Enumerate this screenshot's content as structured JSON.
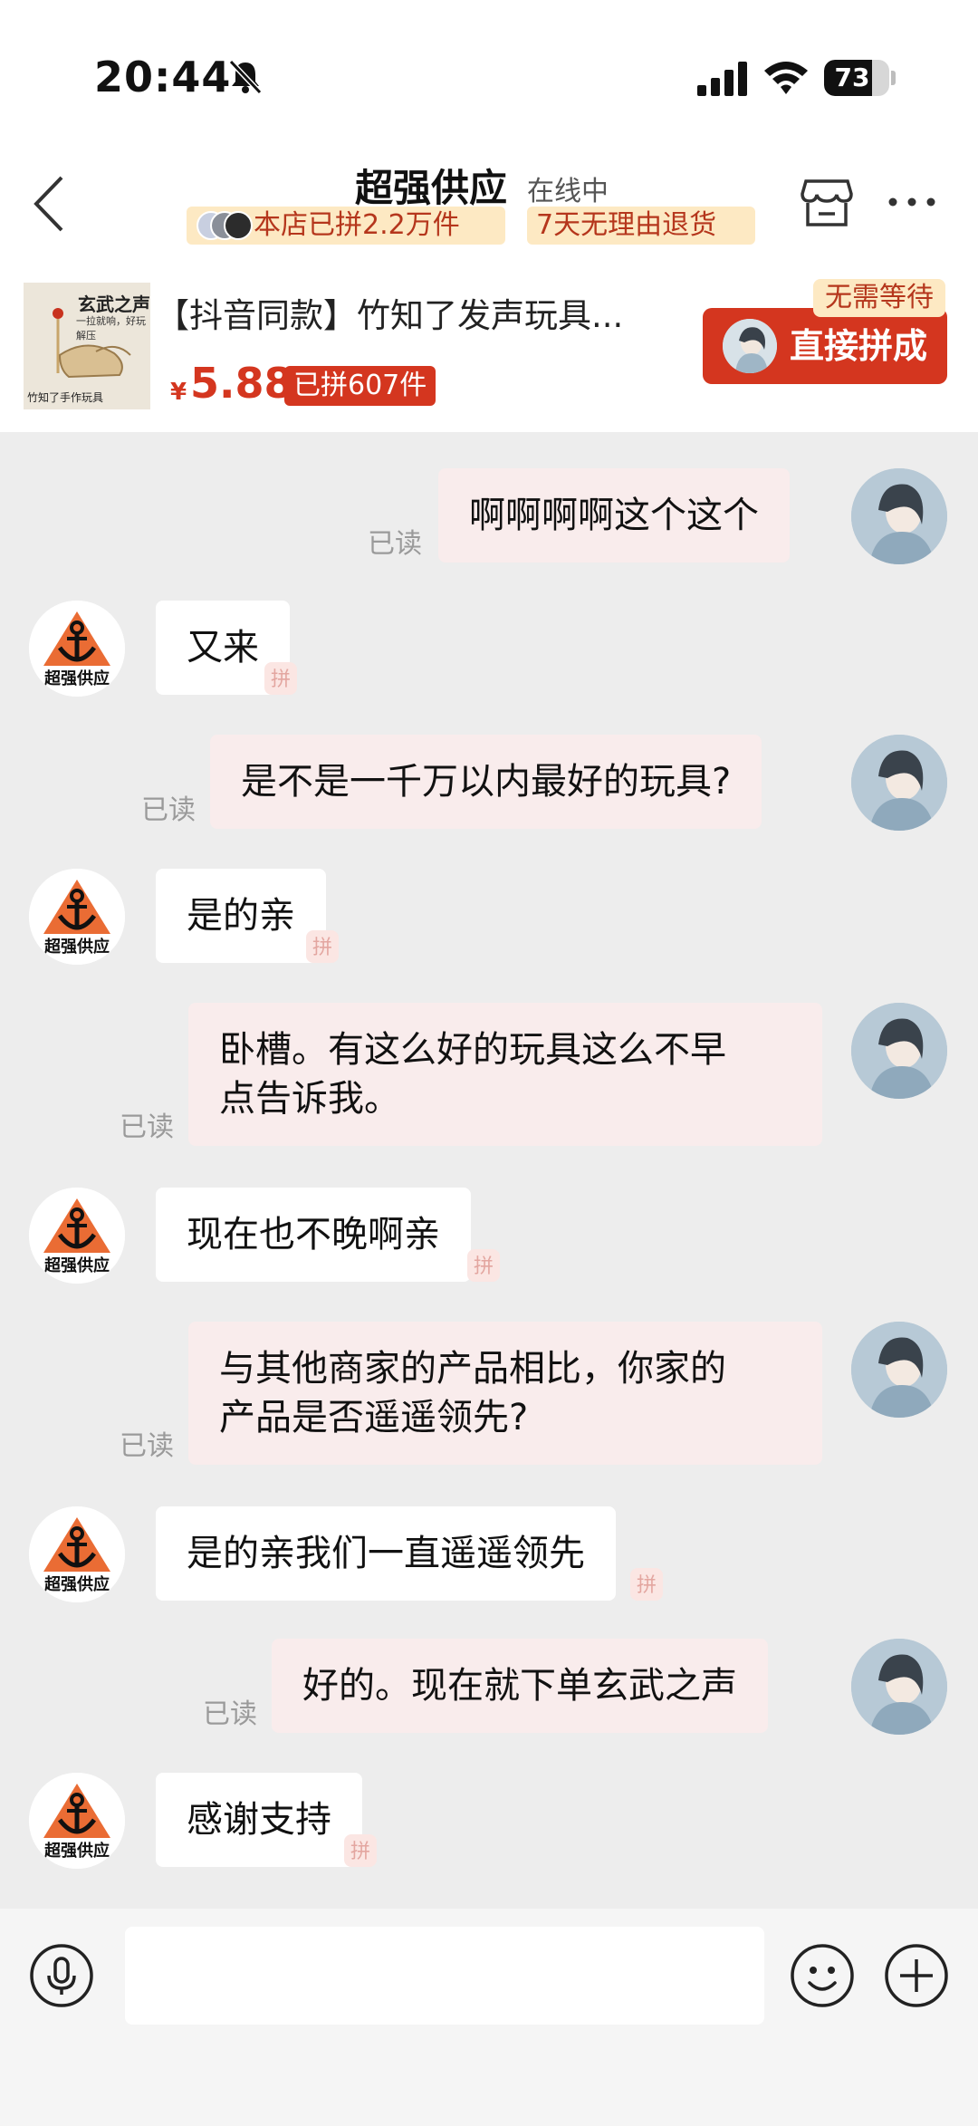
{
  "status_bar": {
    "time": "20:44",
    "battery_level": 73,
    "battery_text": "73"
  },
  "header": {
    "shop_name": "超强供应",
    "online_status": "在线中",
    "badge_group_count": "本店已拼2.2万件",
    "badge_return_policy": "7天无理由退货"
  },
  "product": {
    "thumb_title": "玄武之声",
    "thumb_subtitle": "一拉就响，好玩解压",
    "thumb_footer": "竹知了手作玩具",
    "title": "【抖音同款】竹知了发声玩具...",
    "price_symbol": "¥",
    "price": "5.88",
    "sold_count": "已拼607件",
    "no_wait_label": "无需等待",
    "join_label": "直接拼成"
  },
  "chat": {
    "read_label": "已读",
    "shop_avatar_text": "超强供应",
    "pin_label": "拼",
    "messages": [
      {
        "sender": "user",
        "text": "啊啊啊啊这个这个"
      },
      {
        "sender": "shop",
        "text": "又来"
      },
      {
        "sender": "user",
        "text": "是不是一千万以内最好的玩具?"
      },
      {
        "sender": "shop",
        "text": "是的亲"
      },
      {
        "sender": "user",
        "line1": "卧槽。有这么好的玩具这么不早",
        "line2": "点告诉我。"
      },
      {
        "sender": "shop",
        "text": "现在也不晚啊亲"
      },
      {
        "sender": "user",
        "line1": "与其他商家的产品相比，你家的",
        "line2": "产品是否遥遥领先?"
      },
      {
        "sender": "shop",
        "text": "是的亲我们一直遥遥领先"
      },
      {
        "sender": "user",
        "text": "好的。现在就下单玄武之声"
      },
      {
        "sender": "shop",
        "text": "感谢支持"
      }
    ]
  },
  "input": {
    "placeholder": "",
    "value": ""
  },
  "colors": {
    "accent_red": "#d4361f",
    "badge_bg": "#fde9c3",
    "user_bubble": "#f9ecec",
    "chat_bg": "#ededed"
  }
}
